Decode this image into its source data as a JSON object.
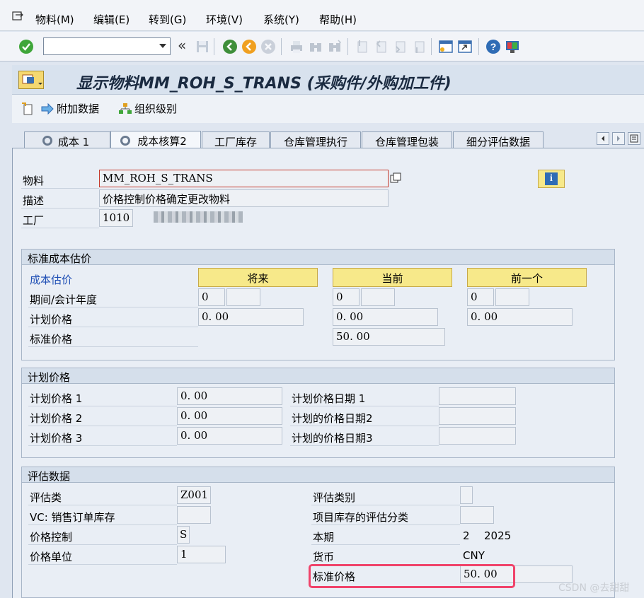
{
  "menubar": {
    "items": [
      "物料(M)",
      "编辑(E)",
      "转到(G)",
      "环境(V)",
      "系统(Y)",
      "帮助(H)"
    ]
  },
  "toolbar": {
    "command_value": "",
    "back_glyph": "«",
    "icons": [
      "enter-icon",
      "save-icon",
      "back-icon",
      "exit-icon",
      "cancel-icon",
      "print-icon",
      "find-icon",
      "find-next-icon",
      "first-page-icon",
      "prev-page-icon",
      "next-page-icon",
      "last-page-icon",
      "new-session-icon",
      "shortcut-icon",
      "help-icon",
      "layout-icon"
    ]
  },
  "title": {
    "text": "显示物料MM_ROH_S_TRANS (采购件/外购加工件)"
  },
  "app_toolbar": {
    "additional_data": "附加数据",
    "org_levels": "组织级别"
  },
  "tabs": [
    {
      "label": "成本 1",
      "active": false
    },
    {
      "label": "成本核算2",
      "active": true
    },
    {
      "label": "工厂库存",
      "active": false
    },
    {
      "label": "仓库管理执行",
      "active": false
    },
    {
      "label": "仓库管理包装",
      "active": false
    },
    {
      "label": "细分评估数据",
      "active": false
    }
  ],
  "header": {
    "material_label": "物料",
    "material_value": "MM_ROH_S_TRANS",
    "desc_label": "描述",
    "desc_value": "价格控制价格确定更改物料",
    "plant_label": "工厂",
    "plant_value": "1010",
    "info_glyph": "i"
  },
  "std_cost": {
    "title": "标准成本估价",
    "row_header": "成本估价",
    "future": "将来",
    "current": "当前",
    "previous": "前一个",
    "period_label": "期间/会计年度",
    "future_period": "0",
    "current_period": "0",
    "previous_period": "0",
    "planned_label": "计划价格",
    "future_planned": "0. 00",
    "current_planned": "0. 00",
    "previous_planned": "0. 00",
    "std_label": "标准价格",
    "current_std": "50. 00"
  },
  "planned": {
    "title": "计划价格",
    "p1_label": "计划价格 1",
    "p1_value": "0. 00",
    "p2_label": "计划价格 2",
    "p2_value": "0. 00",
    "p3_label": "计划价格 3",
    "p3_value": "0. 00",
    "d1_label": "计划价格日期 1",
    "d2_label": "计划的价格日期2",
    "d3_label": "计划的价格日期3"
  },
  "valuation": {
    "title": "评估数据",
    "class_label": "评估类",
    "class_value": "Z001",
    "vc_label": "VC: 销售订单库存",
    "control_label": "价格控制",
    "control_value": "S",
    "unit_label": "价格单位",
    "unit_value": "1",
    "category_label": "评估类别",
    "proj_label": "项目库存的评估分类",
    "period_label": "本期",
    "period_value": "2",
    "year_value": "2025",
    "currency_label": "货币",
    "currency_value": "CNY",
    "std_label": "标准价格",
    "std_value": "50. 00"
  },
  "watermark": "CSDN @去甜甜",
  "colors": {
    "highlight": "#f0436a",
    "button_yellow": "#f7e98a",
    "link_blue": "#1f4fb5"
  }
}
